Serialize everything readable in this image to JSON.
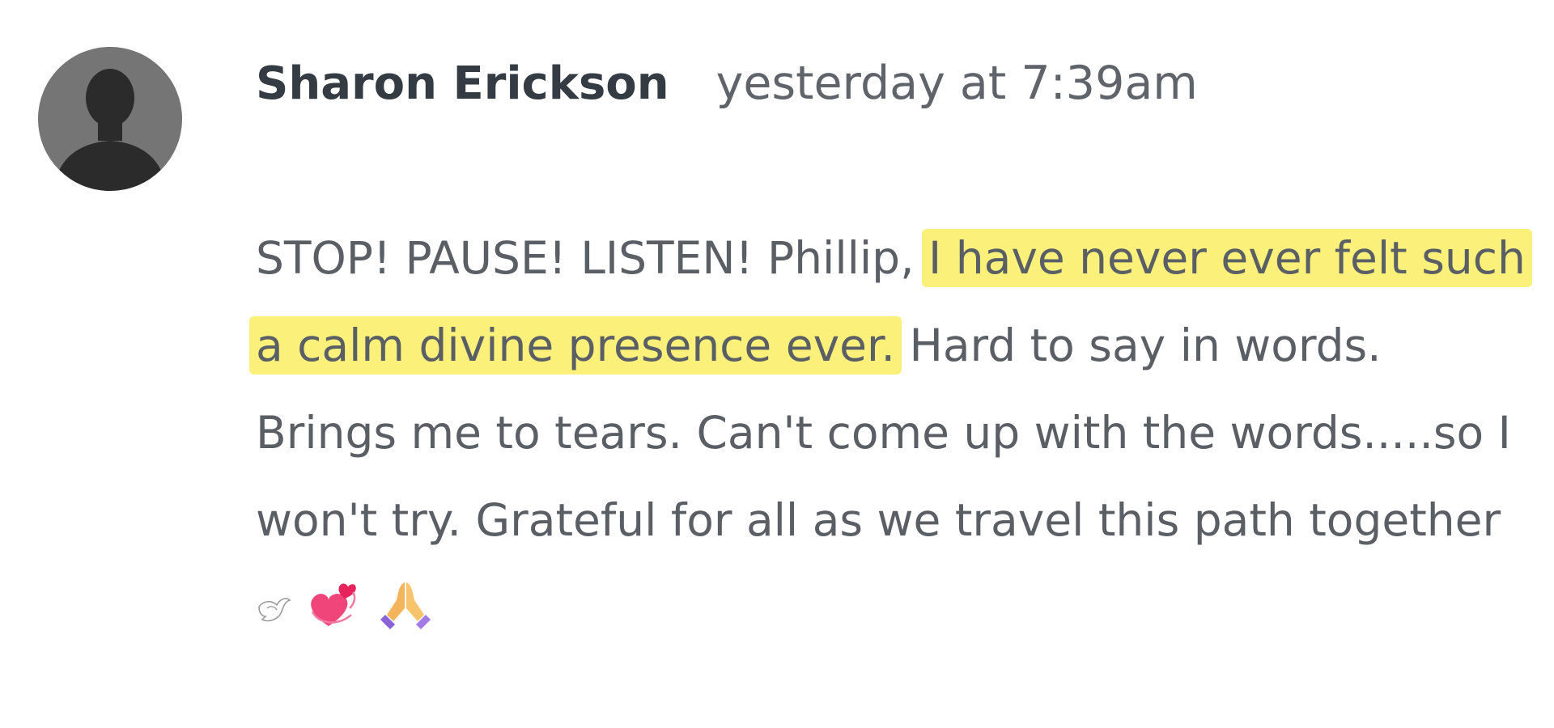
{
  "comment": {
    "author": "Sharon Erickson",
    "timestamp": "yesterday at 7:39am",
    "text_before_highlight": "STOP! PAUSE! LISTEN! Phillip,",
    "highlighted_text": "I have never ever felt such a calm divine presence ever.",
    "text_after_highlight": "Hard to say in words. Brings me to tears. Can't come up with the words.....so I won't try. Grateful for all as we travel this path together",
    "emojis": [
      "dove-emoji",
      "revolving-hearts-emoji",
      "folded-hands-emoji"
    ]
  },
  "colors": {
    "highlight": "#faf07a",
    "author_text": "#343b43",
    "body_text": "#5a5f66",
    "avatar_bg": "#6f6f6f",
    "avatar_silhouette": "#2b2b2b"
  }
}
